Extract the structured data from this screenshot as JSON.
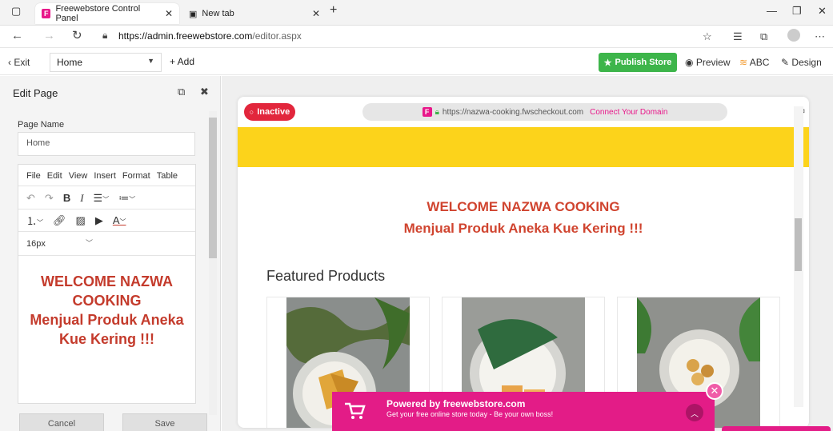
{
  "browser": {
    "tabs": [
      {
        "title": "Freewebstore Control Panel",
        "favicon": "F"
      },
      {
        "title": "New tab"
      }
    ],
    "url_host": "https://admin.freewebstore.com",
    "url_path": "/editor.aspx"
  },
  "toolbar": {
    "exit_label": "‹ Exit",
    "page_select_value": "Home",
    "add_label": "+ Add",
    "publish_label": "Publish Store",
    "preview_label": "Preview",
    "abc_label": "ABC",
    "design_label": "Design",
    "publish_color": "#3db54a"
  },
  "edit_panel": {
    "title": "Edit Page",
    "page_name_label": "Page Name",
    "page_name_value": "Home",
    "editor_menu": [
      "File",
      "Edit",
      "View",
      "Insert",
      "Format",
      "Table"
    ],
    "font_size": "16px",
    "content_line1": "WELCOME NAZWA",
    "content_line2": "COOKING",
    "content_line3": "Menjual Produk Aneka",
    "content_line4": "Kue Kering !!!",
    "cancel_label": "Cancel",
    "save_label": "Save"
  },
  "preview": {
    "status_label": "Inactive",
    "site_url": "https://nazwa-cooking.fwscheckout.com",
    "connect_domain_label": "Connect Your Domain",
    "hero_line1": "WELCOME NAZWA COOKING",
    "hero_line2": "Menjual Produk Aneka Kue Kering !!!",
    "featured_title": "Featured Products",
    "banner_color": "#fcd31b",
    "hero_color": "#d0442f"
  },
  "promo": {
    "title": "Powered by freewebstore.com",
    "subtitle": "Get your free online store today - Be your own boss!",
    "color": "#e31c87"
  }
}
